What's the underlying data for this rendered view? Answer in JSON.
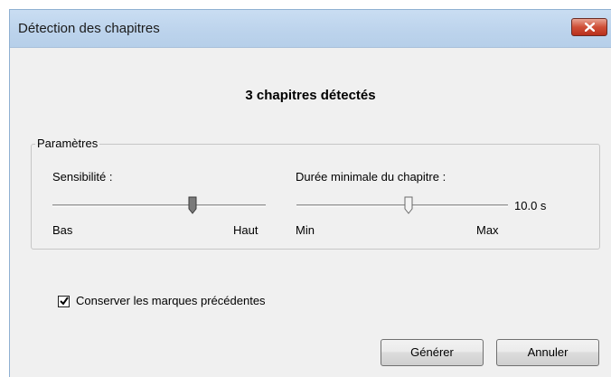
{
  "window": {
    "title": "Détection des chapitres",
    "close_icon": "close-icon"
  },
  "heading": "3 chapitres détectés",
  "parameters": {
    "legend": "Paramètres",
    "sensitivity": {
      "label": "Sensibilité :",
      "min_label": "Bas",
      "max_label": "Haut",
      "level": 0.66
    },
    "min_duration": {
      "label": "Durée minimale du chapitre :",
      "min_label": "Min",
      "max_label": "Max",
      "value_text": "10.0 s",
      "level": 0.53
    }
  },
  "keep_marks": {
    "label": "Conserver les marques précédentes",
    "checked": true
  },
  "buttons": {
    "generate": "Générer",
    "cancel": "Annuler"
  }
}
